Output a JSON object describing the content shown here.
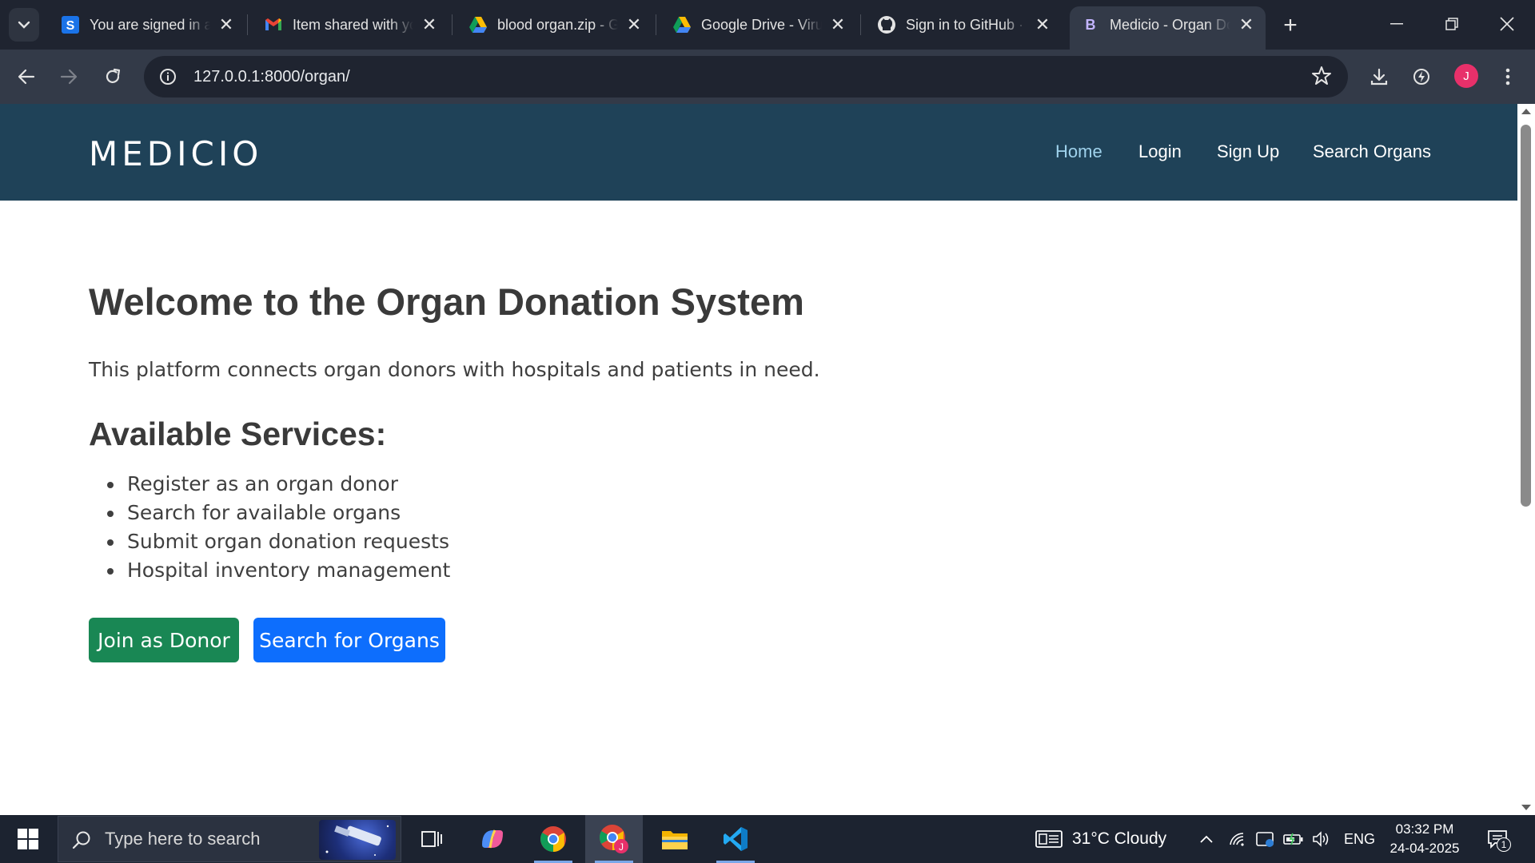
{
  "browser": {
    "tabs": [
      {
        "title": "You are signed in as",
        "favicon": "s-app-icon",
        "favicon_color": "#1a73e8"
      },
      {
        "title": "Item shared with you",
        "favicon": "gmail-icon"
      },
      {
        "title": "blood organ.zip - Google Drive",
        "favicon": "google-drive-icon"
      },
      {
        "title": "Google Drive - Virus scan warning",
        "favicon": "google-drive-icon"
      },
      {
        "title": "Sign in to GitHub · GitHub",
        "favicon": "github-icon"
      },
      {
        "title": "Medicio - Organ Donation",
        "favicon": "bootstrap-icon",
        "favicon_letter": "B",
        "active": true
      }
    ],
    "url": "127.0.0.1:8000/organ/",
    "profile_initial": "J",
    "icons": [
      "tab-search-icon",
      "new-tab-icon",
      "minimize-icon",
      "restore-icon",
      "close-window-icon",
      "back-icon",
      "forward-icon",
      "reload-icon",
      "site-info-icon",
      "bookmark-star-icon",
      "download-icon",
      "performance-icon",
      "menu-kebab-icon"
    ]
  },
  "site": {
    "logo": "MEDICIO",
    "nav": {
      "home": "Home",
      "login": "Login",
      "signup": "Sign Up",
      "search_organs": "Search Organs"
    },
    "title": "Welcome to the Organ Donation System",
    "intro": "This platform connects organ donors with hospitals and patients in need.",
    "services_heading": "Available Services:",
    "services": [
      "Register as an organ donor",
      "Search for available organs",
      "Submit organ donation requests",
      "Hospital inventory management"
    ],
    "buttons": {
      "join_donor": "Join as Donor",
      "search_organs": "Search for Organs"
    },
    "colors": {
      "header_bg": "#1f4258",
      "nav_active": "#9fd2ec",
      "donor_button": "#198754",
      "search_button": "#0d6efd"
    }
  },
  "taskbar": {
    "search_placeholder": "Type here to search",
    "apps": [
      "task-view-icon",
      "copilot-icon",
      "chrome-icon",
      "chrome-profile-icon",
      "file-explorer-icon",
      "vscode-icon"
    ],
    "weather": "31°C  Cloudy",
    "language": "ENG",
    "time": "03:32 PM",
    "date": "24-04-2025",
    "notification_count": "1"
  }
}
